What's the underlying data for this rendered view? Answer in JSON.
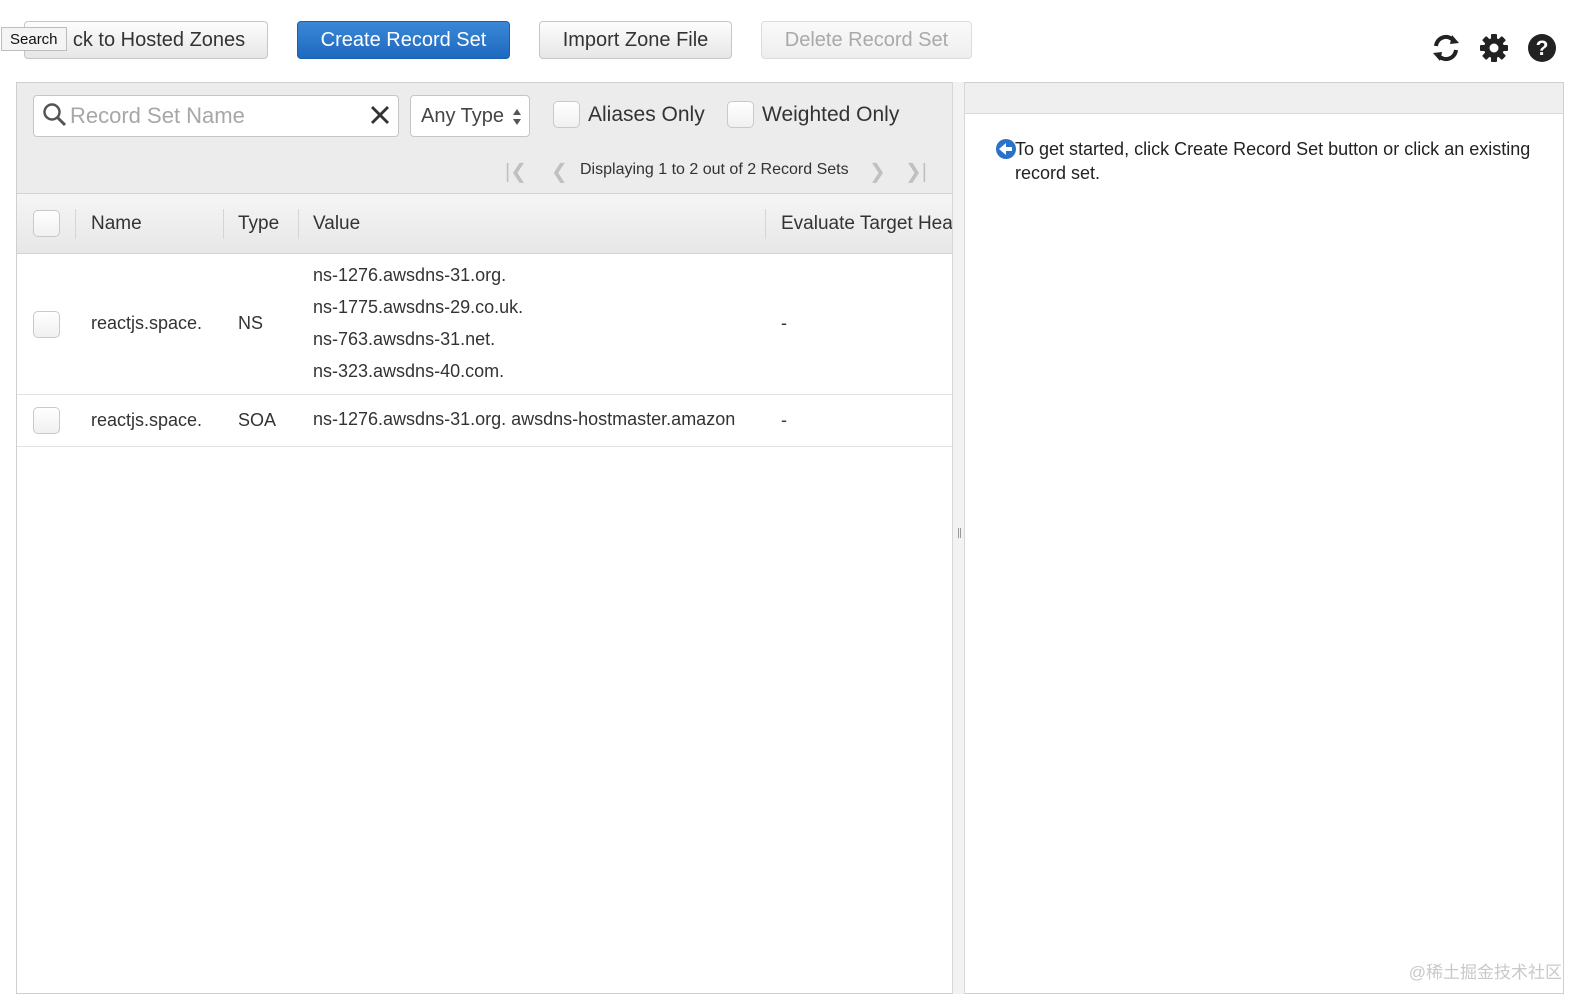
{
  "toolbar": {
    "back_label": "Back to Hosted Zones",
    "back_visible_label": "ck to Hosted Zones",
    "create_label": "Create Record Set",
    "import_label": "Import Zone File",
    "delete_label": "Delete Record Set",
    "tooltip": "Search"
  },
  "icons": {
    "refresh": "refresh-icon",
    "settings": "gear-icon",
    "help": "help-icon"
  },
  "filters": {
    "search_placeholder": "Record Set Name",
    "search_value": "",
    "type_selected": "Any Type",
    "aliases_label": "Aliases Only",
    "weighted_label": "Weighted Only"
  },
  "pagination": {
    "text": "Displaying 1 to 2 out of 2 Record Sets"
  },
  "table": {
    "columns": [
      "Name",
      "Type",
      "Value",
      "Evaluate Target Hea"
    ],
    "rows": [
      {
        "name": "reactjs.space.",
        "type": "NS",
        "values": [
          "ns-1276.awsdns-31.org.",
          "ns-1775.awsdns-29.co.uk.",
          "ns-763.awsdns-31.net.",
          "ns-323.awsdns-40.com."
        ],
        "evaluate": "-"
      },
      {
        "name": "reactjs.space.",
        "type": "SOA",
        "values": [
          "ns-1276.awsdns-31.org. awsdns-hostmaster.amazon"
        ],
        "evaluate": "-"
      }
    ]
  },
  "detail": {
    "hint": "To get started, click Create Record Set button or click an existing record set."
  },
  "watermark": "@稀土掘金技术社区",
  "colors": {
    "primary": "#1f69bf",
    "info_icon": "#2a72c8"
  }
}
